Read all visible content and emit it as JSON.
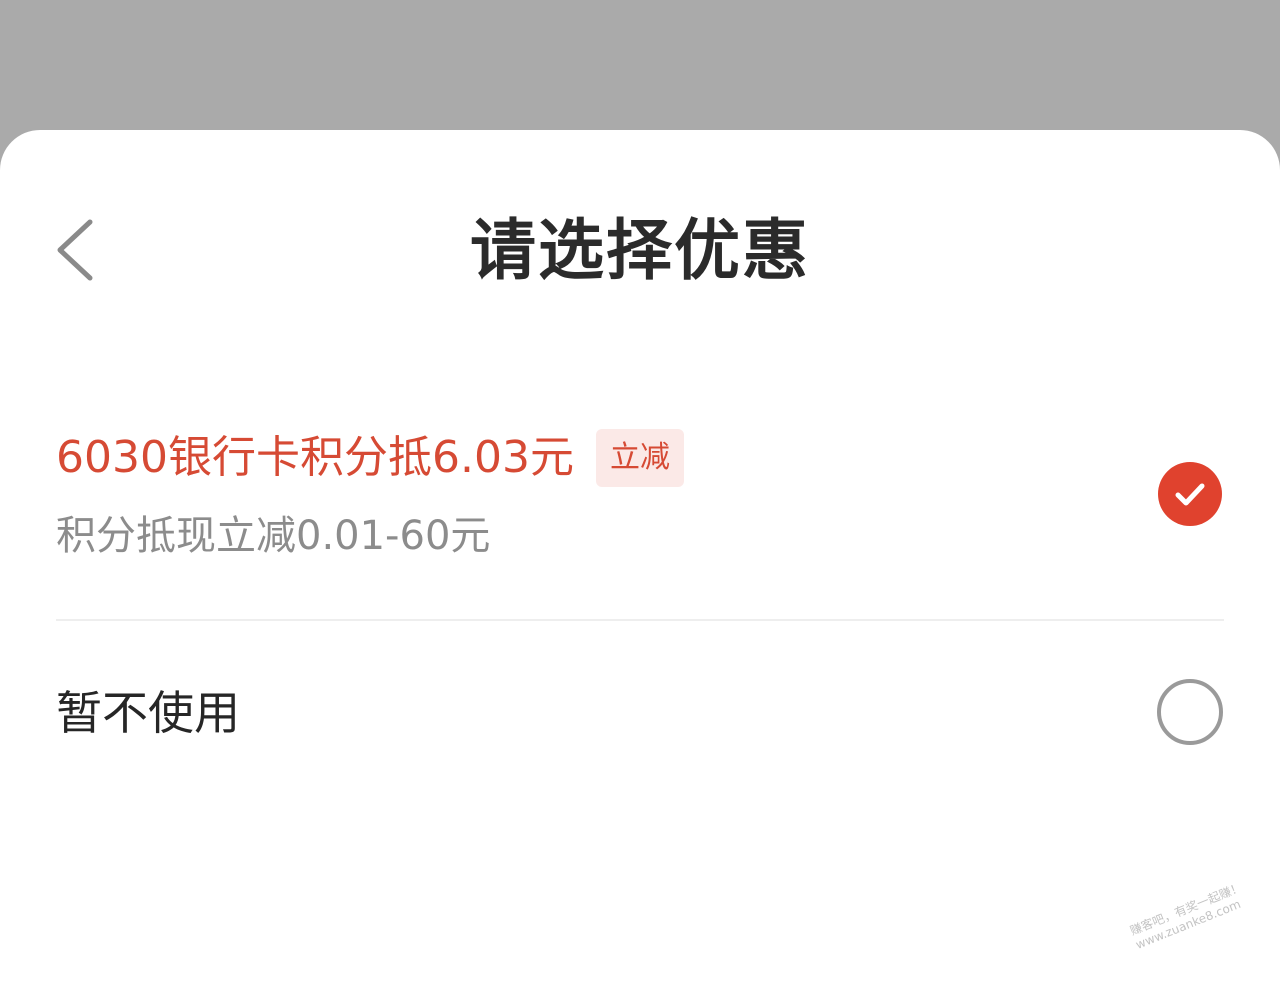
{
  "header": {
    "title": "请选择优惠"
  },
  "options": [
    {
      "title": "6030银行卡积分抵6.03元",
      "tag": "立减",
      "subtitle": "积分抵现立减0.01-60元",
      "selected": true
    },
    {
      "title": "暂不使用",
      "selected": false
    }
  ],
  "watermark": {
    "line1": "赚客吧，有奖一起赚！",
    "line2": "www.zuanke8.com"
  },
  "colors": {
    "backdrop": "#aaaaaa",
    "accent": "#e0422e",
    "accent_text": "#d64a34",
    "tag_bg": "#fbe9e7",
    "secondary_text": "#8c8c8c"
  },
  "icons": {
    "back": "chevron-left-icon",
    "selected": "check-circle-icon",
    "unselected": "empty-circle-icon"
  }
}
